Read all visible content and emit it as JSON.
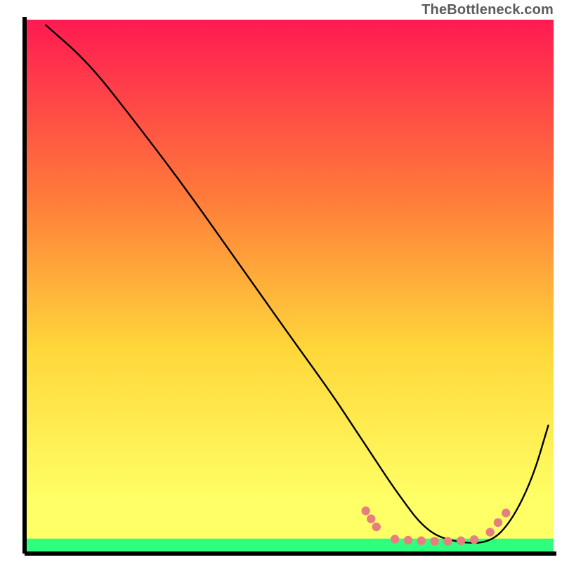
{
  "watermark": "TheBottleneck.com",
  "chart_data": {
    "type": "line",
    "title": "",
    "xlabel": "",
    "ylabel": "",
    "xlim": [
      0,
      100
    ],
    "ylim": [
      0,
      100
    ],
    "grid": false,
    "legend": false,
    "background_gradient": {
      "top": "#ff1a52",
      "mid1": "#ff7a3a",
      "mid2": "#ffd83a",
      "mid3": "#ffff66",
      "bottom_strip": "#2dff7e"
    },
    "series": [
      {
        "name": "curve",
        "color": "#000000",
        "x": [
          4,
          12,
          20,
          30,
          40,
          50,
          58,
          62,
          66,
          70,
          76,
          82,
          88,
          92,
          96,
          99
        ],
        "y": [
          99,
          92,
          82,
          69,
          55,
          41,
          30,
          24,
          18,
          12,
          4,
          2,
          2,
          6,
          14,
          24
        ]
      }
    ],
    "highlight_dots": {
      "name": "bottleneck-zone",
      "color": "#e77f80",
      "points": [
        {
          "x": 64.5,
          "y": 8.0
        },
        {
          "x": 65.5,
          "y": 6.5
        },
        {
          "x": 66.5,
          "y": 5.0
        },
        {
          "x": 70.0,
          "y": 2.7
        },
        {
          "x": 72.5,
          "y": 2.5
        },
        {
          "x": 75.0,
          "y": 2.4
        },
        {
          "x": 77.5,
          "y": 2.3
        },
        {
          "x": 80.0,
          "y": 2.3
        },
        {
          "x": 82.5,
          "y": 2.4
        },
        {
          "x": 85.0,
          "y": 2.6
        },
        {
          "x": 88.0,
          "y": 4.0
        },
        {
          "x": 89.5,
          "y": 5.8
        },
        {
          "x": 91.0,
          "y": 7.6
        }
      ]
    }
  }
}
